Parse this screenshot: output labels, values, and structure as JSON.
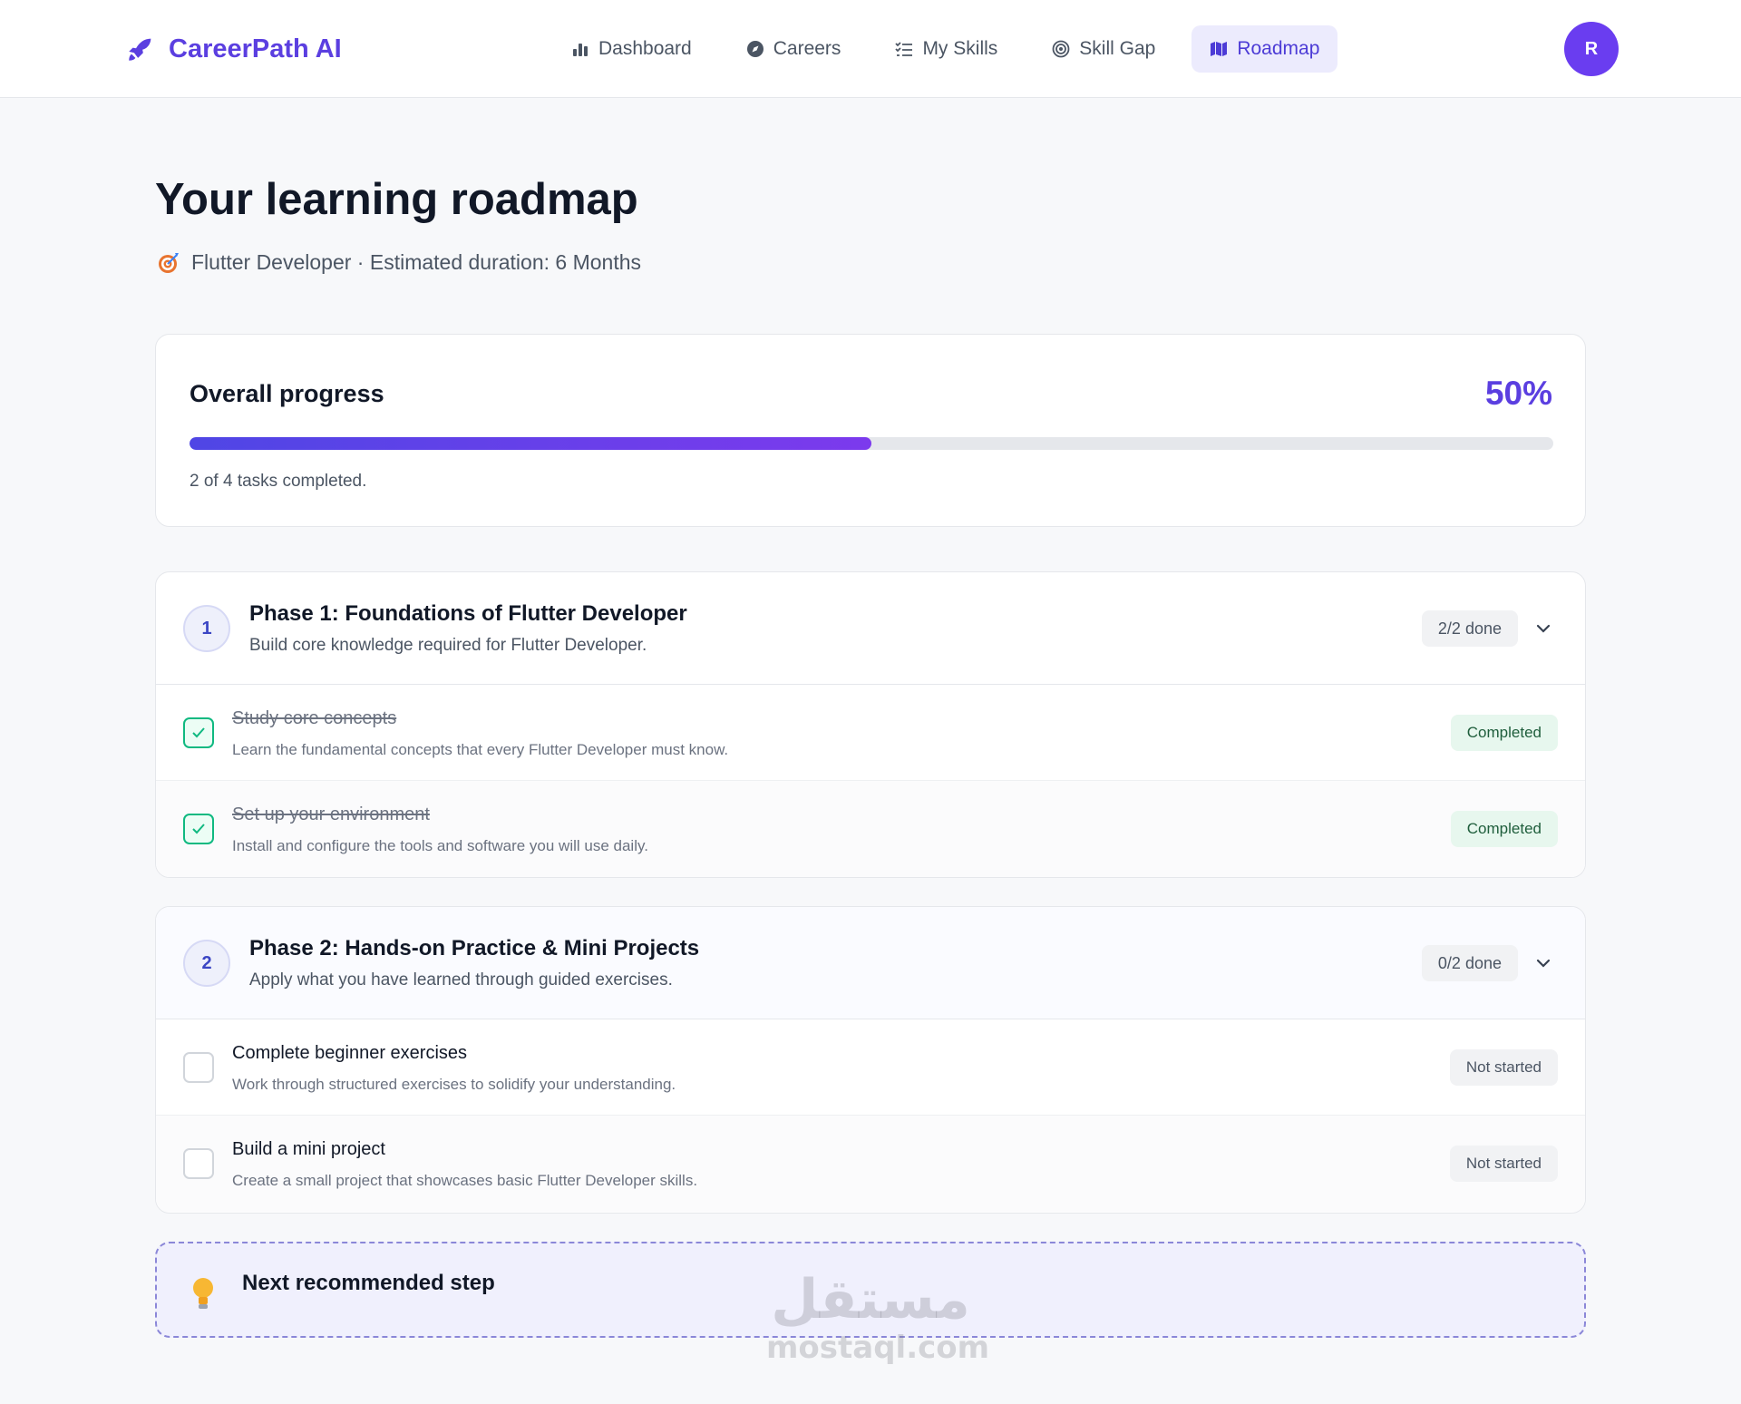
{
  "brand": {
    "name": "CareerPath AI"
  },
  "nav": {
    "items": [
      {
        "label": "Dashboard",
        "icon": "bar-chart-icon"
      },
      {
        "label": "Careers",
        "icon": "compass-icon"
      },
      {
        "label": "My Skills",
        "icon": "checklist-icon"
      },
      {
        "label": "Skill Gap",
        "icon": "target-icon"
      },
      {
        "label": "Roadmap",
        "icon": "map-icon",
        "active": true
      }
    ]
  },
  "user": {
    "avatar_initial": "R"
  },
  "page": {
    "title": "Your learning roadmap",
    "subtitle": "Flutter Developer · Estimated duration: 6 Months"
  },
  "progress": {
    "title": "Overall progress",
    "percent_label": "50%",
    "percent": 50,
    "note": "2 of 4 tasks completed."
  },
  "phases": [
    {
      "number": "1",
      "title": "Phase 1: Foundations of Flutter Developer",
      "description": "Build core knowledge required for Flutter Developer.",
      "count": "2/2 done",
      "tasks": [
        {
          "title": "Study core concepts",
          "description": "Learn the fundamental concepts that every Flutter Developer must know.",
          "status": "Completed",
          "done": true
        },
        {
          "title": "Set up your environment",
          "description": "Install and configure the tools and software you will use daily.",
          "status": "Completed",
          "done": true
        }
      ]
    },
    {
      "number": "2",
      "title": "Phase 2: Hands-on Practice & Mini Projects",
      "description": "Apply what you have learned through guided exercises.",
      "count": "0/2 done",
      "tasks": [
        {
          "title": "Complete beginner exercises",
          "description": "Work through structured exercises to solidify your understanding.",
          "status": "Not started",
          "done": false
        },
        {
          "title": "Build a mini project",
          "description": "Create a small project that showcases basic Flutter Developer skills.",
          "status": "Not started",
          "done": false
        }
      ]
    }
  ],
  "next_step": {
    "title": "Next recommended step"
  },
  "watermark": {
    "arabic": "مستقل",
    "latin": "mostaql.com"
  },
  "colors": {
    "accent": "#5b3fe0",
    "success": "#10b981",
    "avatar": "#6a3df0"
  }
}
